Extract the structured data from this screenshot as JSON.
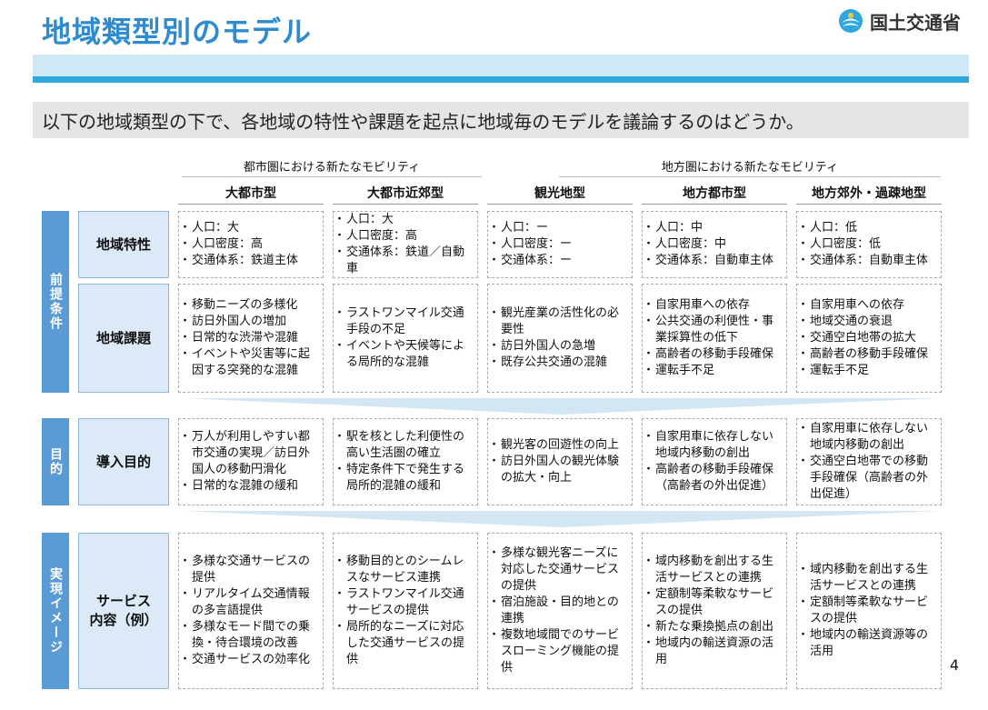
{
  "header": {
    "title": "地域類型別のモデル",
    "ministry": "国土交通省",
    "logo_icon": "mlit-logo-icon"
  },
  "subtitle": "以下の地域類型の下で、各地域の特性や課題を起点に地域毎のモデルを議論するのはどうか。",
  "groups": {
    "urban": "都市圏における新たなモビリティ",
    "rural": "地方圏における新たなモビリティ"
  },
  "columns": [
    "大都市型",
    "大都市近郊型",
    "観光地型",
    "地方都市型",
    "地方郊外・過疎地型"
  ],
  "sections": {
    "premise": "前提条件",
    "purpose": "目的",
    "image": "実現イメージ"
  },
  "rows": {
    "characteristics": {
      "label": "地域特性",
      "cells": [
        [
          "人口：大",
          "人口密度：高",
          "交通体系：鉄道主体"
        ],
        [
          "人口：大",
          "人口密度：高",
          "交通体系：鉄道／自動車"
        ],
        [
          "人口：ー",
          "人口密度：ー",
          "交通体系：ー"
        ],
        [
          "人口：中",
          "人口密度：中",
          "交通体系：自動車主体"
        ],
        [
          "人口：低",
          "人口密度：低",
          "交通体系：自動車主体"
        ]
      ]
    },
    "issues": {
      "label": "地域課題",
      "cells": [
        [
          "移動ニーズの多様化",
          "訪日外国人の増加",
          "日常的な渋滞や混雑",
          "イベントや災害等に起因する突発的な混雑"
        ],
        [
          "ラストワンマイル交通手段の不足",
          "イベントや天候等による局所的な混雑"
        ],
        [
          "観光産業の活性化の必要性",
          "訪日外国人の急増",
          "既存公共交通の混雑"
        ],
        [
          "自家用車への依存",
          "公共交通の利便性・事業採算性の低下",
          "高齢者の移動手段確保",
          "運転手不足"
        ],
        [
          "自家用車への依存",
          "地域交通の衰退",
          "交通空白地帯の拡大",
          "高齢者の移動手段確保",
          "運転手不足"
        ]
      ]
    },
    "purpose": {
      "label": "導入目的",
      "cells": [
        [
          "万人が利用しやすい都市交通の実現／訪日外国人の移動円滑化",
          "日常的な混雑の緩和"
        ],
        [
          "駅を核とした利便性の高い生活圏の確立",
          "特定条件下で発生する局所的混雑の緩和"
        ],
        [
          "観光客の回遊性の向上",
          "訪日外国人の観光体験の拡大・向上"
        ],
        [
          "自家用車に依存しない地域内移動の創出",
          "高齢者の移動手段確保（高齢者の外出促進）"
        ],
        [
          "自家用車に依存しない地域内移動の創出",
          "交通空白地帯での移動手段確保（高齢者の外出促進）"
        ]
      ]
    },
    "service": {
      "label": "サービス\n内容（例）",
      "cells": [
        [
          "多様な交通サービスの提供",
          "リアルタイム交通情報の多言語提供",
          "多様なモード間での乗換・待合環境の改善",
          "交通サービスの効率化"
        ],
        [
          "移動目的とのシームレスなサービス連携",
          "ラストワンマイル交通サービスの提供",
          "局所的なニーズに対応した交通サービスの提供"
        ],
        [
          "多様な観光客ニーズに対応した交通サービスの提供",
          "宿泊施設・目的地との連携",
          "複数地域間でのサービスローミング機能の提供"
        ],
        [
          "域内移動を創出する生活サービスとの連携",
          "定額制等柔軟なサービスの提供",
          "新たな乗換拠点の創出",
          "地域内の輸送資源の活用"
        ],
        [
          "域内移動を創出する生活サービスとの連携",
          "定額制等柔軟なサービスの提供",
          "地域内の輸送資源等の活用"
        ]
      ]
    }
  },
  "page_number": "4",
  "colors": {
    "title": "#2f8bd0",
    "band_light": "#cfe8f5",
    "band_dark": "#2ea8df",
    "side_label": "#5b9bd5",
    "row_label_bg": "#dce9f6",
    "chevron": "#d3e6f4"
  }
}
